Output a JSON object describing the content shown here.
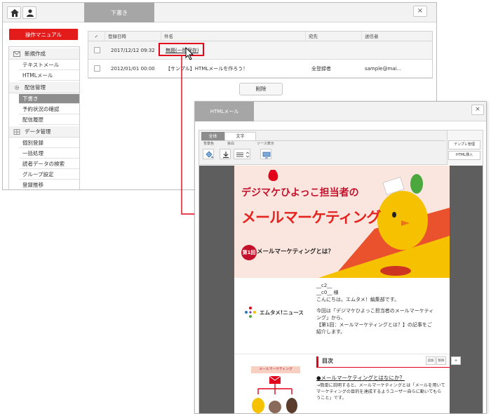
{
  "back_window": {
    "draft_tab": "下書き",
    "close_label": "×",
    "manual_button": "操作マニュアル",
    "sidebar": {
      "sections": [
        {
          "title": "新規作成",
          "icon": "mail-icon",
          "items": [
            "テキストメール",
            "HTMLメール"
          ]
        },
        {
          "title": "配信管理",
          "icon": "gear-icon",
          "items": [
            "下書き",
            "予約状況の確認",
            "配信履歴"
          ]
        },
        {
          "title": "データ管理",
          "icon": "grid-icon",
          "items": [
            "個別登録",
            "一括処理",
            "読者データの検索",
            "グループ設定",
            "登録推移"
          ]
        }
      ],
      "active_item": "下書き"
    },
    "table": {
      "headers": [
        "✓",
        "登録日時",
        "件名",
        "宛先",
        "送信者"
      ],
      "rows": [
        {
          "date": "2017/12/12 09:32",
          "subject": "無題(一時保存)",
          "to": "",
          "from": ""
        },
        {
          "date": "2012/01/01 00:00",
          "subject": "【サンプル】HTMLメールを作ろう！",
          "to": "全登録者",
          "from": "sample@mai..."
        }
      ]
    },
    "delete_button": "削除"
  },
  "front_window": {
    "tab": "HTMLメール",
    "close_label": "×",
    "editor_tabs": [
      "全体",
      "文字"
    ],
    "toolbar_labels": [
      "背景色",
      "余白",
      "ソース表示"
    ],
    "side_buttons": [
      "テンプレ管理",
      "HTML挿入"
    ],
    "banner": {
      "title_line1": "デジマケひよっこ担当者の",
      "title_line2": "メールマーケティング",
      "badge": "第1回",
      "subtitle": "メールマーケティングとは？"
    },
    "logo_text": "エムタメ!ニュース",
    "greeting_lines": [
      "__c2__",
      "__c0__ 様",
      "こんにちは。エムタメ！編集部です。",
      "",
      "今回は「デジマケひよっこ担当者のメールマーケティ",
      "ング」から、",
      "【第1回：メールマーケティングとは？】の記事をご",
      "紹介します。"
    ],
    "toc": {
      "heading": "目次",
      "mini_buttons": [
        "追加",
        "削除",
        "✢"
      ],
      "link": "●メールマーケティングとはなにか？",
      "body": [
        "→簡単に説明すると、メールマーケティングとは「メールを用いて",
        "マーケティングの目的を達成するようユーザー自らに動いてもら",
        "うこと」です。"
      ],
      "mini_banner_label": "メールマーケティング"
    }
  },
  "colors": {
    "accent_red": "#e3001b",
    "tab_gray": "#a6a6a6",
    "banner_yellow": "#f6c200"
  }
}
